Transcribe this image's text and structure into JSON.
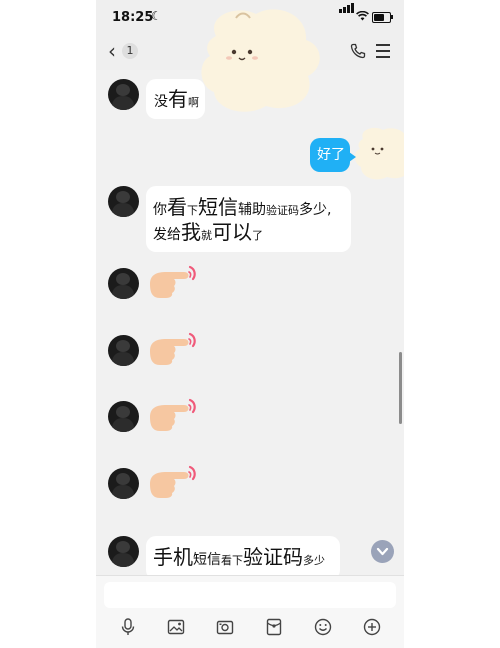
{
  "status_bar": {
    "time": "18:25"
  },
  "nav": {
    "back_count": "1"
  },
  "messages": [
    {
      "dir": "in",
      "parts": [
        {
          "t": "没",
          "s": "n"
        },
        {
          "t": "有",
          "s": "b"
        },
        {
          "t": "啊",
          "s": "s"
        }
      ]
    },
    {
      "dir": "out",
      "text": "好了"
    },
    {
      "dir": "in",
      "lines": [
        [
          {
            "t": "你",
            "s": "n"
          },
          {
            "t": "看",
            "s": "b"
          },
          {
            "t": "下",
            "s": "s"
          },
          {
            "t": "短信",
            "s": "b"
          },
          {
            "t": "辅助",
            "s": "n"
          },
          {
            "t": "验证码",
            "s": "s"
          },
          {
            "t": "多少,",
            "s": "n"
          }
        ],
        [
          {
            "t": "发给",
            "s": "n"
          },
          {
            "t": "我",
            "s": "b"
          },
          {
            "t": "就",
            "s": "s"
          },
          {
            "t": "可以",
            "s": "b"
          },
          {
            "t": "了",
            "s": "s"
          }
        ]
      ]
    },
    {
      "dir": "in",
      "emoji": "pointing-hand"
    },
    {
      "dir": "in",
      "emoji": "pointing-hand"
    },
    {
      "dir": "in",
      "emoji": "pointing-hand"
    },
    {
      "dir": "in",
      "emoji": "pointing-hand"
    },
    {
      "dir": "in",
      "parts": [
        {
          "t": "手机",
          "s": "b"
        },
        {
          "t": "短信",
          "s": "n"
        },
        {
          "t": "看下",
          "s": "s"
        },
        {
          "t": "验证码",
          "s": "b"
        },
        {
          "t": "多少",
          "s": "s"
        }
      ]
    }
  ],
  "m1": {
    "p1": "没",
    "p2": "有",
    "p3": "啊"
  },
  "m2": {
    "text": "好了"
  },
  "m3": {
    "l1": {
      "a": "你",
      "b": "看",
      "c": "下",
      "d": "短信",
      "e": "辅助",
      "f": "验证码",
      "g": "多少,"
    },
    "l2": {
      "a": "发给",
      "b": "我",
      "c": "就",
      "d": "可以",
      "e": "了"
    }
  },
  "m8": {
    "a": "手机",
    "b": "短信",
    "c": "看下",
    "d": "验证码",
    "e": "多少"
  },
  "toolbar": {
    "icons": [
      "microphone-icon",
      "image-icon",
      "camera-icon",
      "red-packet-icon",
      "emoji-icon",
      "plus-icon"
    ]
  },
  "colors": {
    "outgoing_bubble": "#20b0f5",
    "incoming_bubble": "#ffffff",
    "chat_bg": "#f1f1f1"
  }
}
